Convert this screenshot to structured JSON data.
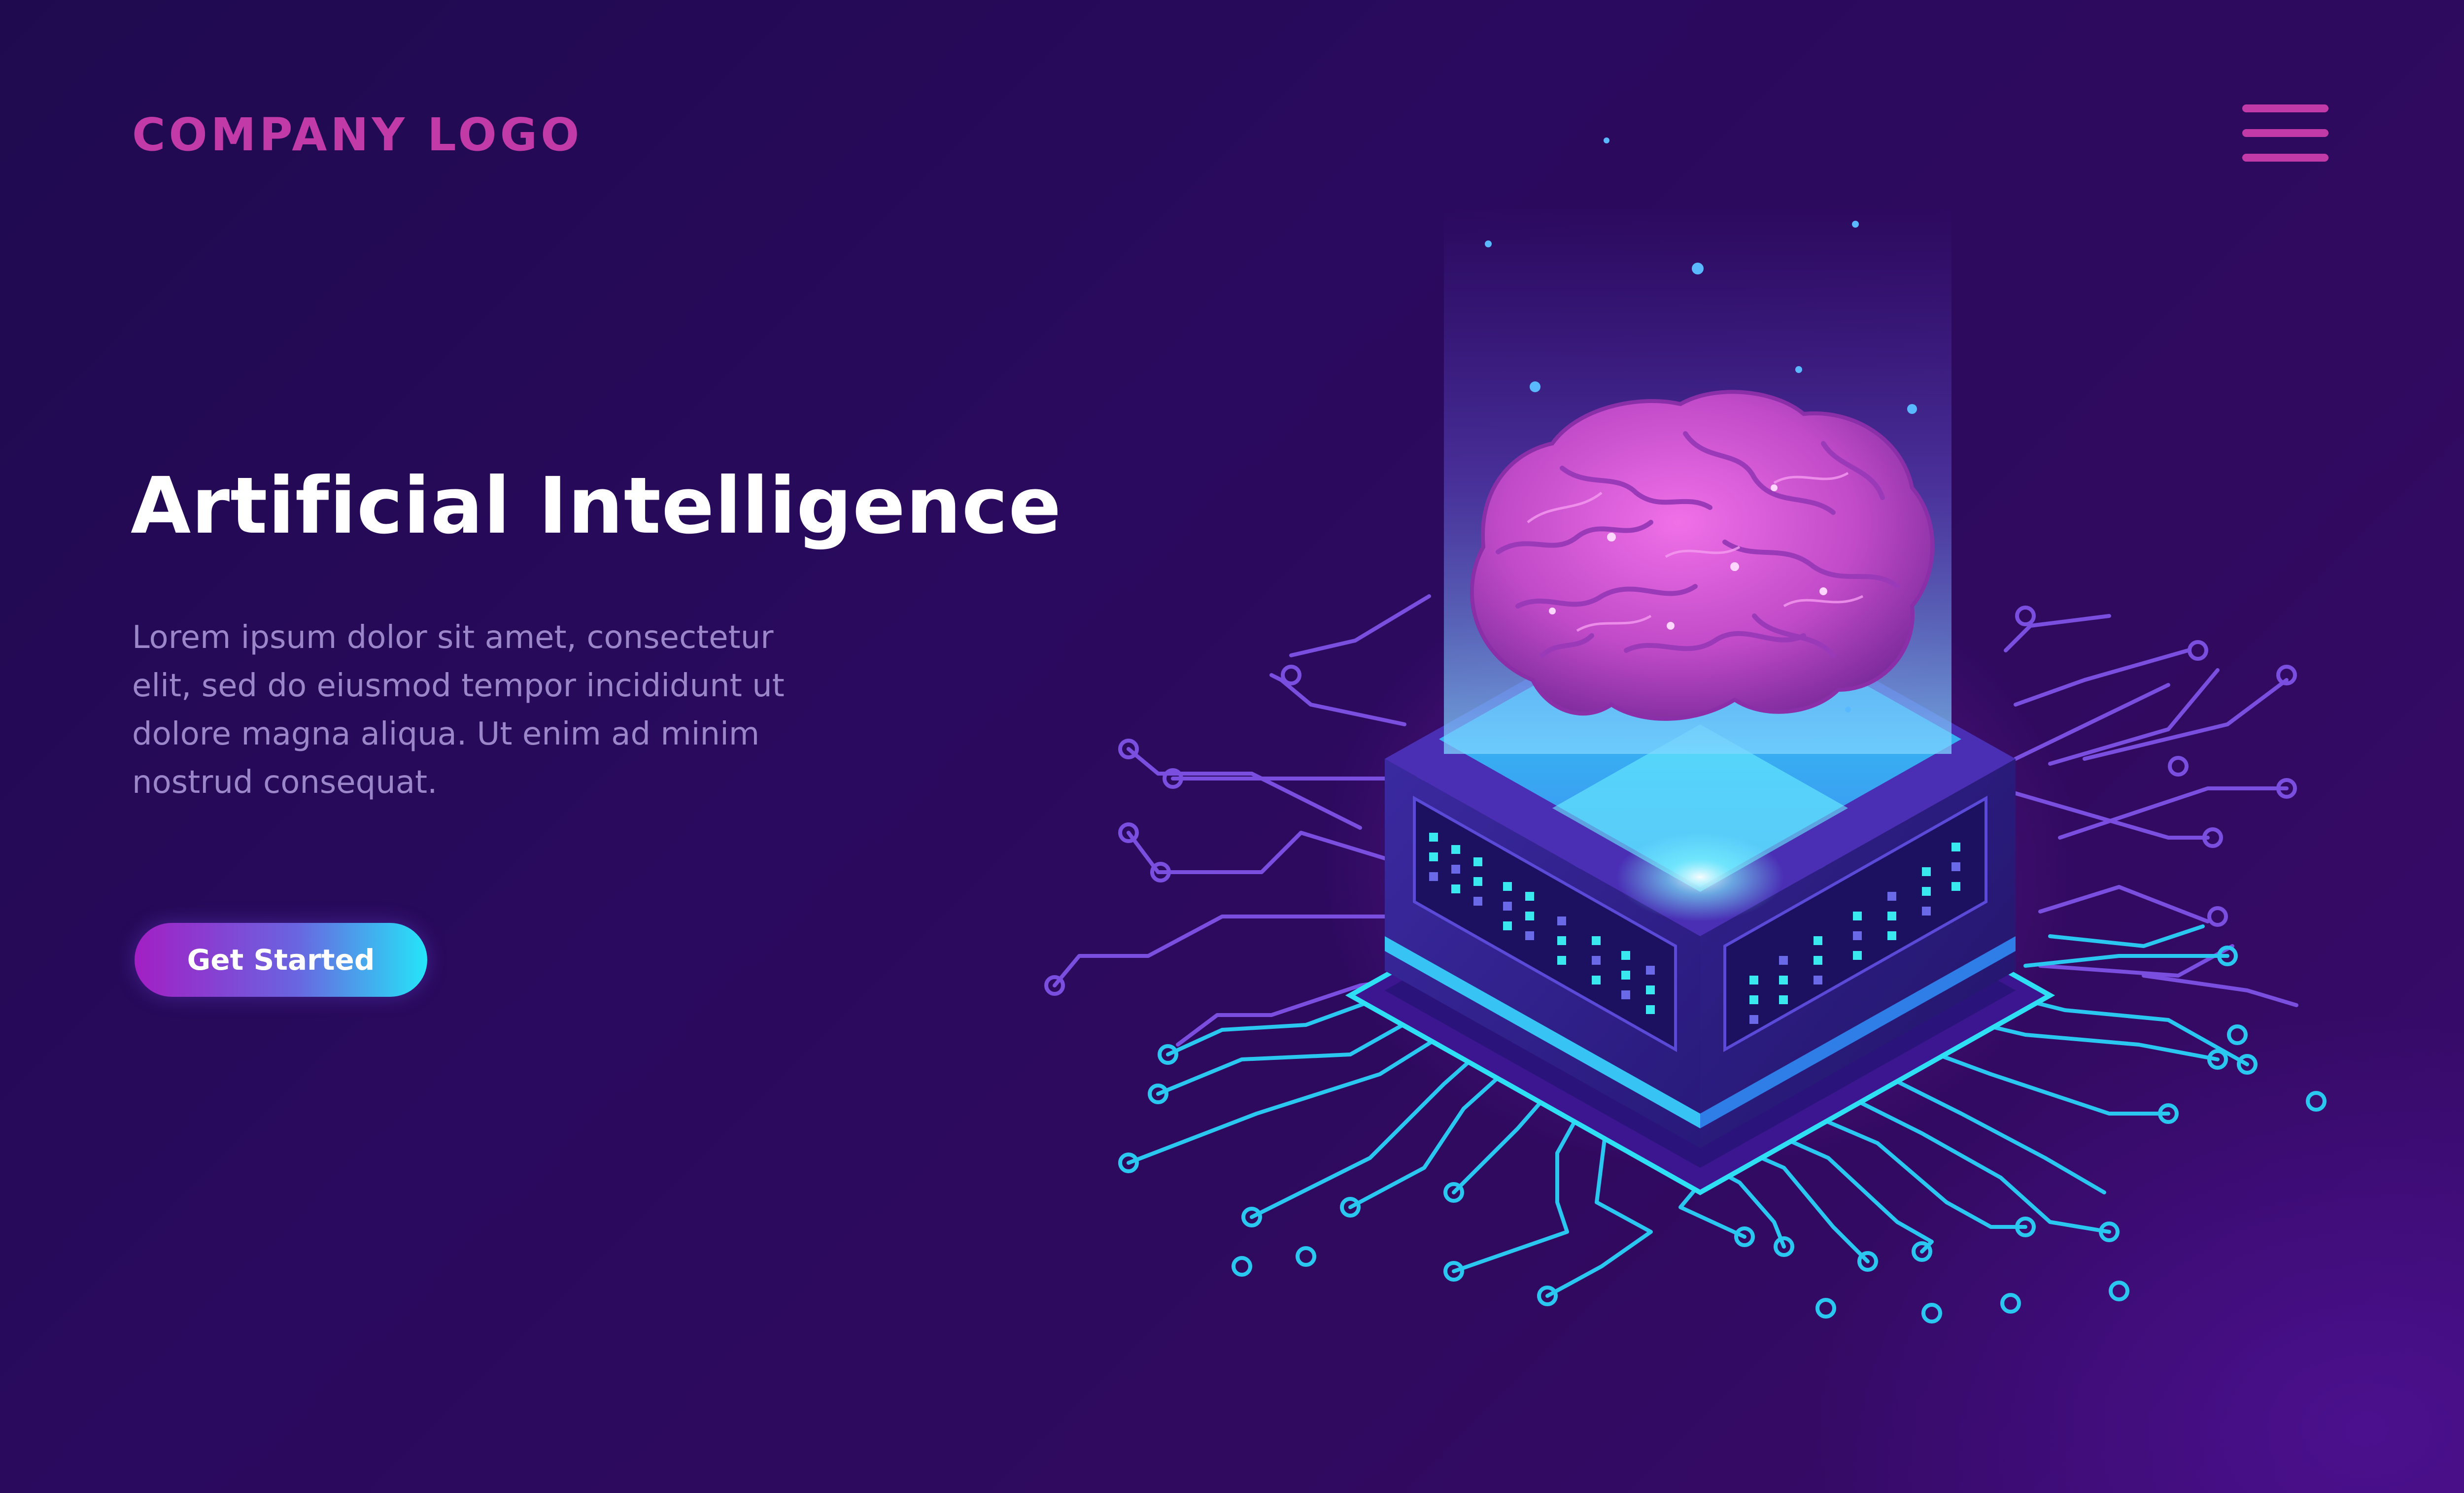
{
  "header": {
    "logo_text": "COMPANY LOGO",
    "menu_icon": "hamburger-menu-icon"
  },
  "hero": {
    "title": "Artificial Intelligence",
    "body": "Lorem ipsum dolor sit amet, consectetur elit, sed do eiusmod tempor incididunt ut dolore magna aliqua. Ut enim ad minim nostrud consequat.",
    "cta_label": "Get Started"
  },
  "illustration": {
    "subject": "brain-icon",
    "base": "processor-chip-icon"
  },
  "colors": {
    "background": "#2a0a5e",
    "accent_magenta": "#c23aa8",
    "accent_cyan": "#25e5f8",
    "text_primary": "#ffffff",
    "text_secondary": "#9a86c8"
  }
}
